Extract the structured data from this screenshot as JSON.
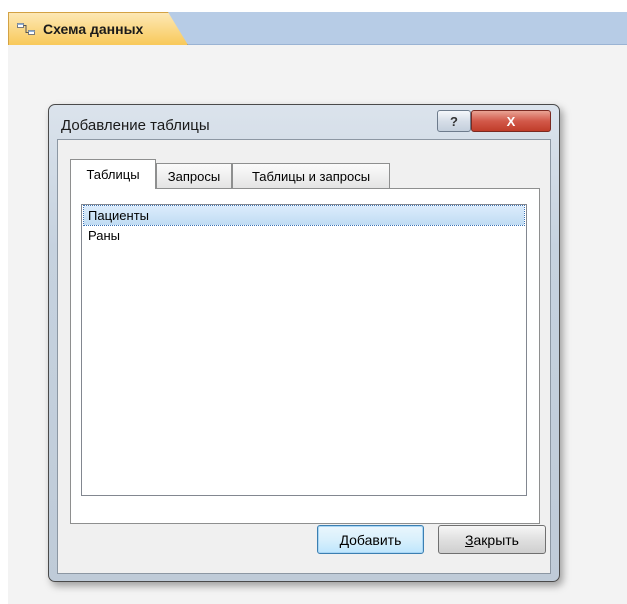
{
  "document_tab": {
    "icon": "relationships-icon",
    "label": "Схема данных"
  },
  "dialog": {
    "title": "Добавление таблицы",
    "help_label": "?",
    "close_label": "X",
    "tabs": [
      {
        "label": "Таблицы",
        "active": true
      },
      {
        "label": "Запросы",
        "active": false
      },
      {
        "label": "Таблицы и запросы",
        "active": false
      }
    ],
    "list_items": [
      {
        "label": "Пациенты",
        "selected": true
      },
      {
        "label": "Раны",
        "selected": false
      }
    ],
    "buttons": {
      "add_hotkey": "Д",
      "add_rest": "обавить",
      "close_hotkey": "З",
      "close_rest": "акрыть"
    }
  },
  "colors": {
    "tab_accent": "#f8c95a",
    "tabstrip": "#b7cce6",
    "close_button": "#d2594a",
    "selection": "#cce8ff"
  }
}
